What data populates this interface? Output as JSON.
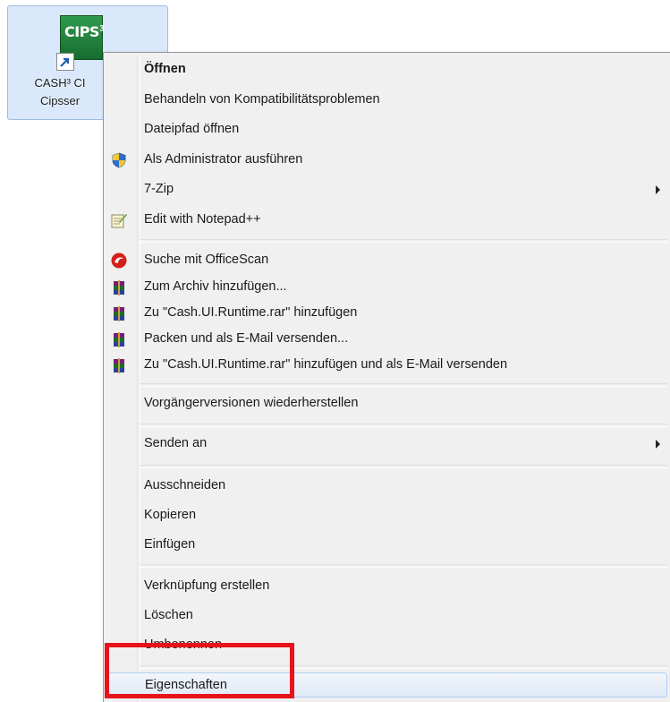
{
  "desktop_icon": {
    "logo_text": "CIPS",
    "logo_sup": "3",
    "label_line1": "CASH³ CI",
    "label_line2": "Cipsser"
  },
  "context_menu": {
    "items": [
      {
        "label": "Öffnen",
        "icon": "",
        "bold": true,
        "submenu": false
      },
      {
        "label": "Behandeln von Kompatibilitätsproblemen",
        "icon": "",
        "bold": false,
        "submenu": false
      },
      {
        "label": "Dateipfad öffnen",
        "icon": "",
        "bold": false,
        "submenu": false
      },
      {
        "label": "Als Administrator ausführen",
        "icon": "uac-shield-icon",
        "bold": false,
        "submenu": false
      },
      {
        "label": "7-Zip",
        "icon": "",
        "bold": false,
        "submenu": true
      },
      {
        "label": "Edit with Notepad++",
        "icon": "notepad-plus-plus-icon",
        "bold": false,
        "submenu": false
      },
      {
        "label": "Suche mit OfficeScan",
        "icon": "officescan-icon",
        "bold": false,
        "submenu": false
      },
      {
        "label": "Zum Archiv hinzufügen...",
        "icon": "winrar-icon",
        "bold": false,
        "submenu": false
      },
      {
        "label": "Zu \"Cash.UI.Runtime.rar\" hinzufügen",
        "icon": "winrar-icon",
        "bold": false,
        "submenu": false
      },
      {
        "label": "Packen und als E-Mail versenden...",
        "icon": "winrar-icon",
        "bold": false,
        "submenu": false
      },
      {
        "label": "Zu \"Cash.UI.Runtime.rar\" hinzufügen und als E-Mail versenden",
        "icon": "winrar-icon",
        "bold": false,
        "submenu": false
      },
      {
        "label": "Vorgängerversionen wiederherstellen",
        "icon": "",
        "bold": false,
        "submenu": false
      },
      {
        "label": "Senden an",
        "icon": "",
        "bold": false,
        "submenu": true
      },
      {
        "label": "Ausschneiden",
        "icon": "",
        "bold": false,
        "submenu": false
      },
      {
        "label": "Kopieren",
        "icon": "",
        "bold": false,
        "submenu": false
      },
      {
        "label": "Einfügen",
        "icon": "",
        "bold": false,
        "submenu": false
      },
      {
        "label": "Verknüpfung erstellen",
        "icon": "",
        "bold": false,
        "submenu": false
      },
      {
        "label": "Löschen",
        "icon": "",
        "bold": false,
        "submenu": false
      },
      {
        "label": "Umbenennen",
        "icon": "",
        "bold": false,
        "submenu": false
      },
      {
        "label": "Eigenschaften",
        "icon": "",
        "bold": false,
        "submenu": false,
        "hovered": true
      }
    ]
  },
  "colors": {
    "menu_background": "#f0f0f0",
    "highlight_box": "#e8121a",
    "icon_selection": "#d9e8fa"
  }
}
